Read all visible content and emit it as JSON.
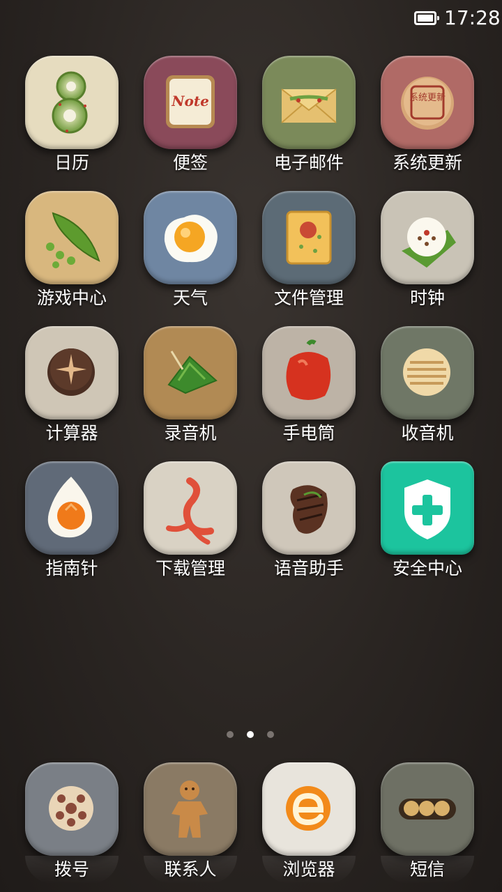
{
  "status_bar": {
    "time": "17:28",
    "battery_icon": "battery-full-icon"
  },
  "apps": [
    {
      "label": "日历",
      "icon": "calendar-icon"
    },
    {
      "label": "便签",
      "icon": "note-icon"
    },
    {
      "label": "电子邮件",
      "icon": "email-icon"
    },
    {
      "label": "系统更新",
      "icon": "system-update-icon"
    },
    {
      "label": "游戏中心",
      "icon": "game-center-icon"
    },
    {
      "label": "天气",
      "icon": "weather-icon"
    },
    {
      "label": "文件管理",
      "icon": "file-manager-icon"
    },
    {
      "label": "时钟",
      "icon": "clock-icon"
    },
    {
      "label": "计算器",
      "icon": "calculator-icon"
    },
    {
      "label": "录音机",
      "icon": "recorder-icon"
    },
    {
      "label": "手电筒",
      "icon": "flashlight-icon"
    },
    {
      "label": "收音机",
      "icon": "radio-icon"
    },
    {
      "label": "指南针",
      "icon": "compass-icon"
    },
    {
      "label": "下载管理",
      "icon": "download-manager-icon"
    },
    {
      "label": "语音助手",
      "icon": "voice-assistant-icon"
    },
    {
      "label": "安全中心",
      "icon": "security-center-icon"
    }
  ],
  "note_icon_text": "Note",
  "update_stamp_text": "系统更新",
  "page_indicator": {
    "count": 3,
    "active_index": 1
  },
  "dock": [
    {
      "label": "拨号",
      "icon": "phone-icon"
    },
    {
      "label": "联系人",
      "icon": "contacts-icon"
    },
    {
      "label": "浏览器",
      "icon": "browser-icon"
    },
    {
      "label": "短信",
      "icon": "messages-icon"
    }
  ]
}
